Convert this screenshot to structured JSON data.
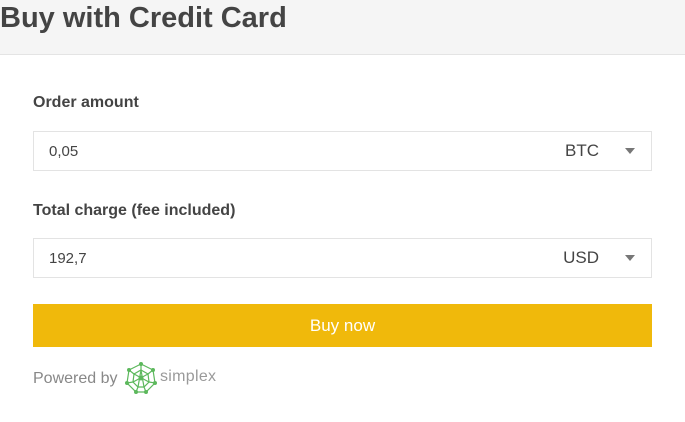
{
  "header": {
    "title": "Buy with Credit Card"
  },
  "order": {
    "label": "Order amount",
    "value": "0,05",
    "currency": "BTC"
  },
  "total": {
    "label": "Total charge (fee included)",
    "value": "192,7",
    "currency": "USD"
  },
  "buy_button": {
    "label": "Buy now"
  },
  "footer": {
    "powered_by": "Powered by",
    "logo_text": "simplex",
    "logo_icon": "simplex-network-icon"
  },
  "colors": {
    "accent": "#f0b90b",
    "logo_green": "#5cb85c",
    "text": "#444444"
  }
}
